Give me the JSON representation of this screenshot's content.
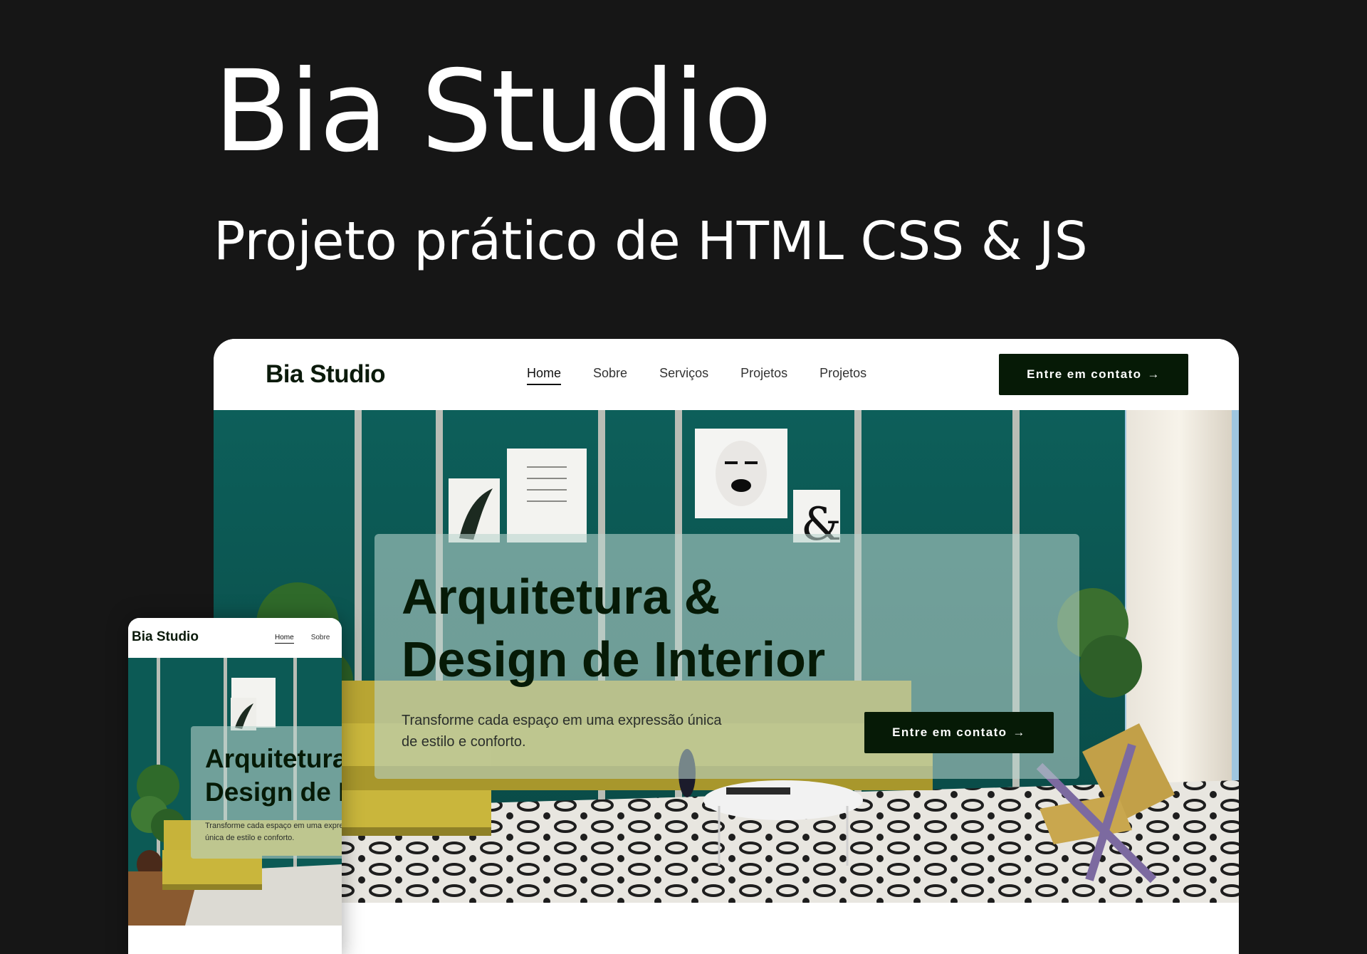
{
  "headline": {
    "title": "Bia Studio",
    "subtitle": "Projeto prático de HTML CSS & JS"
  },
  "desktop": {
    "logo": "Bia Studio",
    "nav": [
      {
        "label": "Home",
        "active": true
      },
      {
        "label": "Sobre",
        "active": false
      },
      {
        "label": "Serviços",
        "active": false
      },
      {
        "label": "Projetos",
        "active": false
      },
      {
        "label": "Projetos",
        "active": false
      }
    ],
    "nav_cta": {
      "label": "Entre em contato",
      "icon": "arrow-right-icon"
    },
    "hero": {
      "title_line1": "Arquitetura &",
      "title_line2": "Design de Interior",
      "text": "Transforme cada espaço em uma expressão única de estilo e conforto.",
      "cta": {
        "label": "Entre em contato",
        "icon": "arrow-right-icon"
      }
    }
  },
  "mobile": {
    "logo": "Bia Studio",
    "nav": [
      {
        "label": "Home",
        "active": true
      },
      {
        "label": "Sobre",
        "active": false
      }
    ],
    "hero": {
      "title_line1": "Arquitetura &",
      "title_line2": "Design de Interior",
      "text_line1": "Transforme cada espaço em uma expressão",
      "text_line2": "única de estilo e conforto."
    }
  },
  "colors": {
    "page_background": "#161616",
    "brand_dark_green": "#061a06",
    "wall_teal": "#0b5a55",
    "sofa_yellow": "#c7b33a",
    "card_glass": "#b9d4cd"
  }
}
